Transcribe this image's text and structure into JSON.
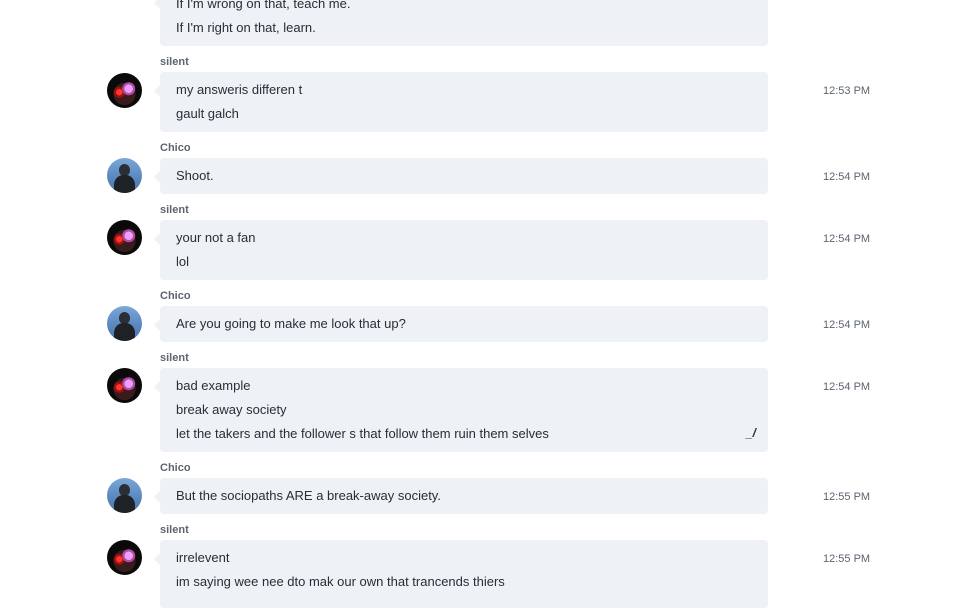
{
  "messages": [
    {
      "author": "",
      "time": "",
      "lines": [
        "If I'm wrong on that, teach me.",
        "If I'm right on that, learn."
      ]
    },
    {
      "author": "silent",
      "time": "12:53 PM",
      "lines": [
        "my answeris differen t",
        "gault galch"
      ]
    },
    {
      "author": "Chico",
      "time": "12:54 PM",
      "lines": [
        "Shoot."
      ]
    },
    {
      "author": "silent",
      "time": "12:54 PM",
      "lines": [
        "your not a fan",
        "lol"
      ]
    },
    {
      "author": "Chico",
      "time": "12:54 PM",
      "lines": [
        "Are you going to make me look that up?"
      ]
    },
    {
      "author": "silent",
      "time": "12:54 PM",
      "lines": [
        "bad example",
        "break away society",
        "let the takers and the follower s that follow them ruin them selves"
      ]
    },
    {
      "author": "Chico",
      "time": "12:55 PM",
      "lines": [
        "But the sociopaths ARE a break-away society."
      ]
    },
    {
      "author": "silent",
      "time": "12:55 PM",
      "lines": [
        "irrelevent",
        "im saying wee nee dto mak our own that trancends thiers"
      ]
    }
  ],
  "icons": {
    "edit": "edit-pencil-icon"
  },
  "colors": {
    "bubble_bg": "#eef1f6",
    "meta_text": "#5d6470",
    "body_text": "#2a2d33"
  }
}
